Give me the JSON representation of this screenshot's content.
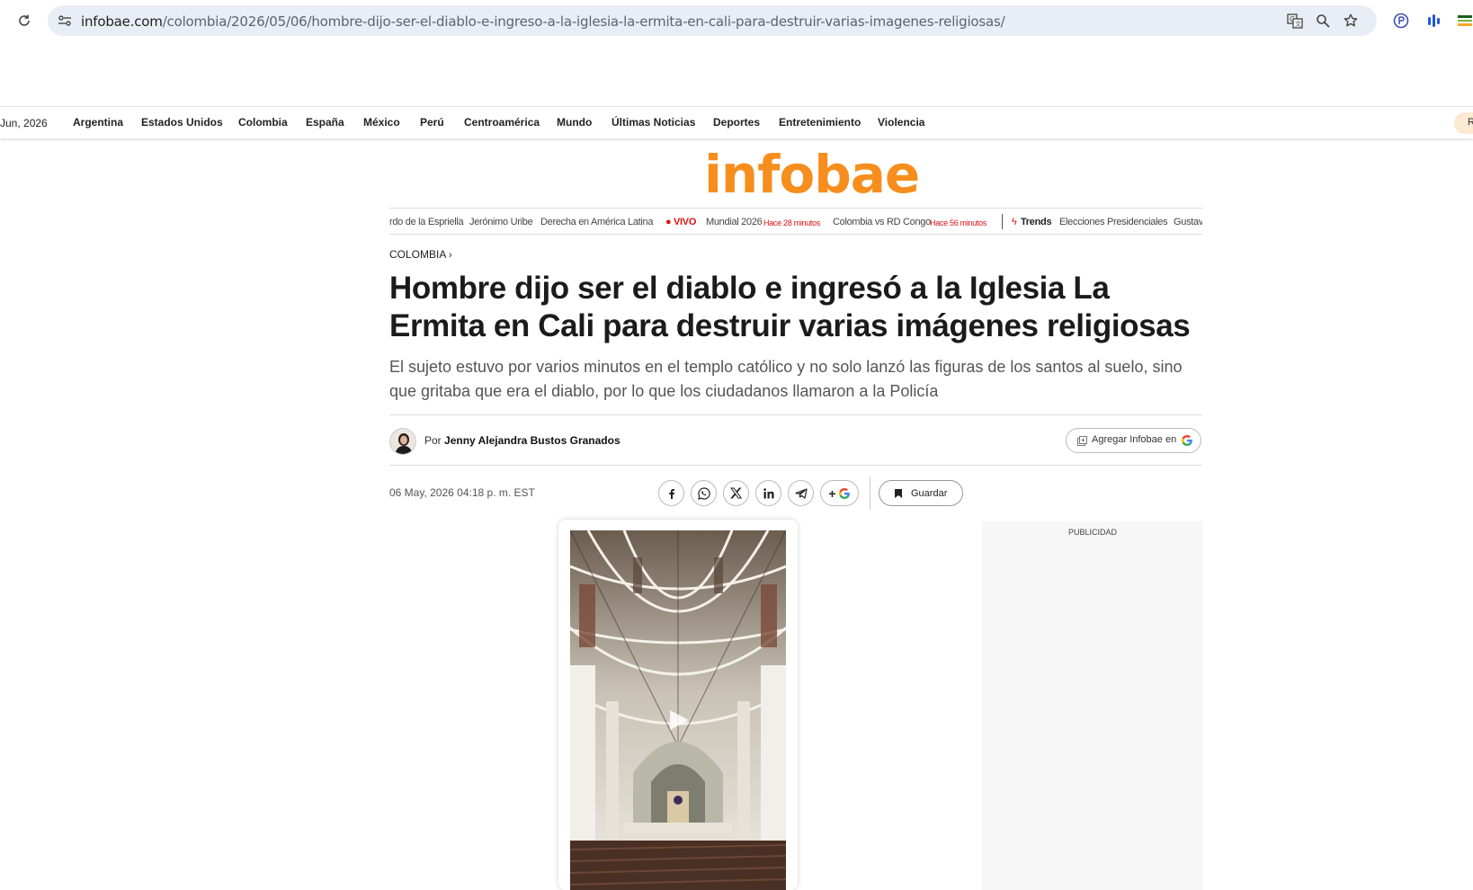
{
  "browser": {
    "url_host": "infobae.com",
    "url_path": "/colombia/2026/05/06/hombre-dijo-ser-el-diablo-e-ingreso-a-la-iglesia-la-ermita-en-cali-para-destruir-varias-imagenes-religiosas/",
    "icons": [
      "reload-icon",
      "site-info-icon",
      "translate-icon",
      "zoom-icon",
      "bookmark-star-icon",
      "extension-icon",
      "extension-icon",
      "extension-icon"
    ]
  },
  "nav": {
    "date": "Jun, 2026",
    "items": [
      "Argentina",
      "Estados Unidos",
      "Colombia",
      "España",
      "México",
      "Perú",
      "Centroamérica",
      "Mundo",
      "Últimas Noticias",
      "Deportes",
      "Entretenimiento",
      "Violencia"
    ],
    "right_pill": "R"
  },
  "logo": "infobae",
  "ticker": {
    "t1": "rdo de la Espriella",
    "t2": "Jerónimo Uribe",
    "t3": "Derecha en América Latina",
    "vivo": "VIVO",
    "t4": "Mundial 2026",
    "t4_time": "Hace 28 minutos",
    "t5": "Colombia vs RD Congo",
    "t5_time": "Hace 56 minutos",
    "trends": "Trends",
    "t6": "Elecciones Presidenciales",
    "t7": "Gustav"
  },
  "article": {
    "section": "COLOMBIA",
    "headline": "Hombre dijo ser el diablo e ingresó a la Iglesia La Ermita en Cali para destruir varias imágenes religiosas",
    "deck": "El sujeto estuvo por varios minutos en el templo católico y no solo lanzó las figuras de los santos al suelo, sino que gritaba que era el diablo, por lo que los ciudadanos llamaron a la Policía",
    "by_prefix": "Por",
    "author": "Jenny Alejandra Bustos Granados",
    "google_btn": "Agregar Infobae en",
    "date": "06 May, 2026 04:18 p. m. EST",
    "save": "Guardar",
    "share_icons": [
      "facebook-icon",
      "whatsapp-icon",
      "x-icon",
      "linkedin-icon",
      "telegram-icon",
      "google-plus-icon"
    ]
  },
  "ad": {
    "label": "PUBLICIDAD"
  }
}
